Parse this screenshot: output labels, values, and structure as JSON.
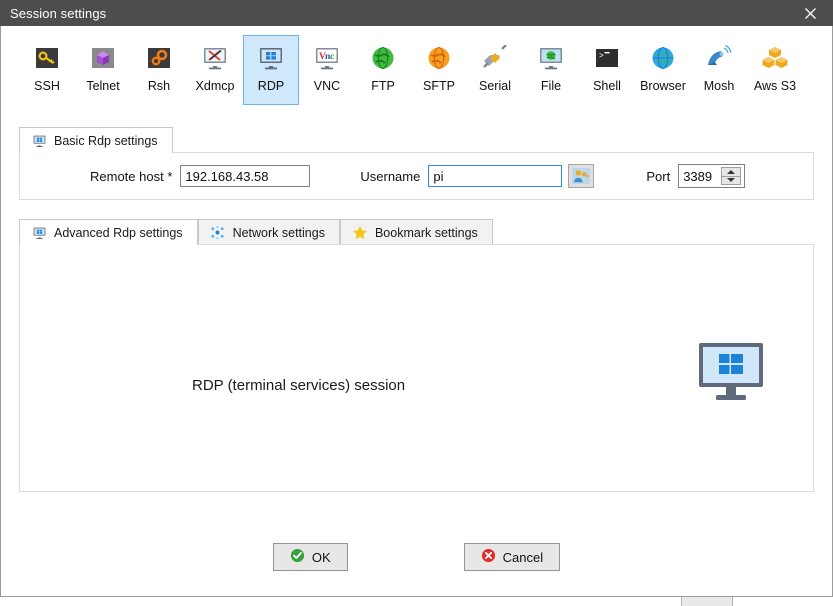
{
  "window": {
    "title": "Session settings",
    "close_label": "✕"
  },
  "protocols": [
    {
      "id": "ssh",
      "label": "SSH",
      "icon": "ssh-key-icon",
      "selected": false
    },
    {
      "id": "telnet",
      "label": "Telnet",
      "icon": "telnet-cube-icon",
      "selected": false
    },
    {
      "id": "rsh",
      "label": "Rsh",
      "icon": "rsh-gears-icon",
      "selected": false
    },
    {
      "id": "xdmcp",
      "label": "Xdmcp",
      "icon": "xdmcp-monitor-icon",
      "selected": false
    },
    {
      "id": "rdp",
      "label": "RDP",
      "icon": "rdp-monitor-icon",
      "selected": true
    },
    {
      "id": "vnc",
      "label": "VNC",
      "icon": "vnc-monitor-icon",
      "selected": false
    },
    {
      "id": "ftp",
      "label": "FTP",
      "icon": "ftp-globe-icon",
      "selected": false
    },
    {
      "id": "sftp",
      "label": "SFTP",
      "icon": "sftp-globe-icon",
      "selected": false
    },
    {
      "id": "serial",
      "label": "Serial",
      "icon": "serial-plug-icon",
      "selected": false
    },
    {
      "id": "file",
      "label": "File",
      "icon": "file-monitor-icon",
      "selected": false
    },
    {
      "id": "shell",
      "label": "Shell",
      "icon": "shell-terminal-icon",
      "selected": false
    },
    {
      "id": "browser",
      "label": "Browser",
      "icon": "browser-globe-icon",
      "selected": false
    },
    {
      "id": "mosh",
      "label": "Mosh",
      "icon": "mosh-satellite-icon",
      "selected": false
    },
    {
      "id": "awss3",
      "label": "Aws S3",
      "icon": "aws-s3-cubes-icon",
      "selected": false
    }
  ],
  "basic": {
    "tab_label": "Basic Rdp settings",
    "tab_icon": "rdp-monitor-icon",
    "remote_host": {
      "label": "Remote host *",
      "value": "192.168.43.58",
      "placeholder": ""
    },
    "username": {
      "label": "Username",
      "value": "pi",
      "placeholder": "",
      "focused": true
    },
    "credentials_button_icon": "user-key-icon",
    "port": {
      "label": "Port",
      "value": "3389"
    }
  },
  "advanced": {
    "tabs": [
      {
        "id": "advanced",
        "label": "Advanced Rdp settings",
        "icon": "rdp-monitor-icon",
        "active": true
      },
      {
        "id": "network",
        "label": "Network settings",
        "icon": "network-nodes-icon",
        "active": false
      },
      {
        "id": "bookmark",
        "label": "Bookmark settings",
        "icon": "star-icon",
        "active": false
      }
    ],
    "description": "RDP (terminal services) session",
    "illustration_icon": "windows-monitor-icon"
  },
  "footer": {
    "ok": {
      "label": "OK",
      "icon": "check-circle-icon"
    },
    "cancel": {
      "label": "Cancel",
      "icon": "x-circle-icon"
    }
  },
  "colors": {
    "titlebar": "#4d4d4d",
    "selection": "#cfe8fb",
    "selection_border": "#6cb3e8",
    "focus_border": "#2b8bd8",
    "ok_green": "#35a13a",
    "cancel_red": "#e02b2b",
    "accent_orange": "#f29a1e"
  }
}
